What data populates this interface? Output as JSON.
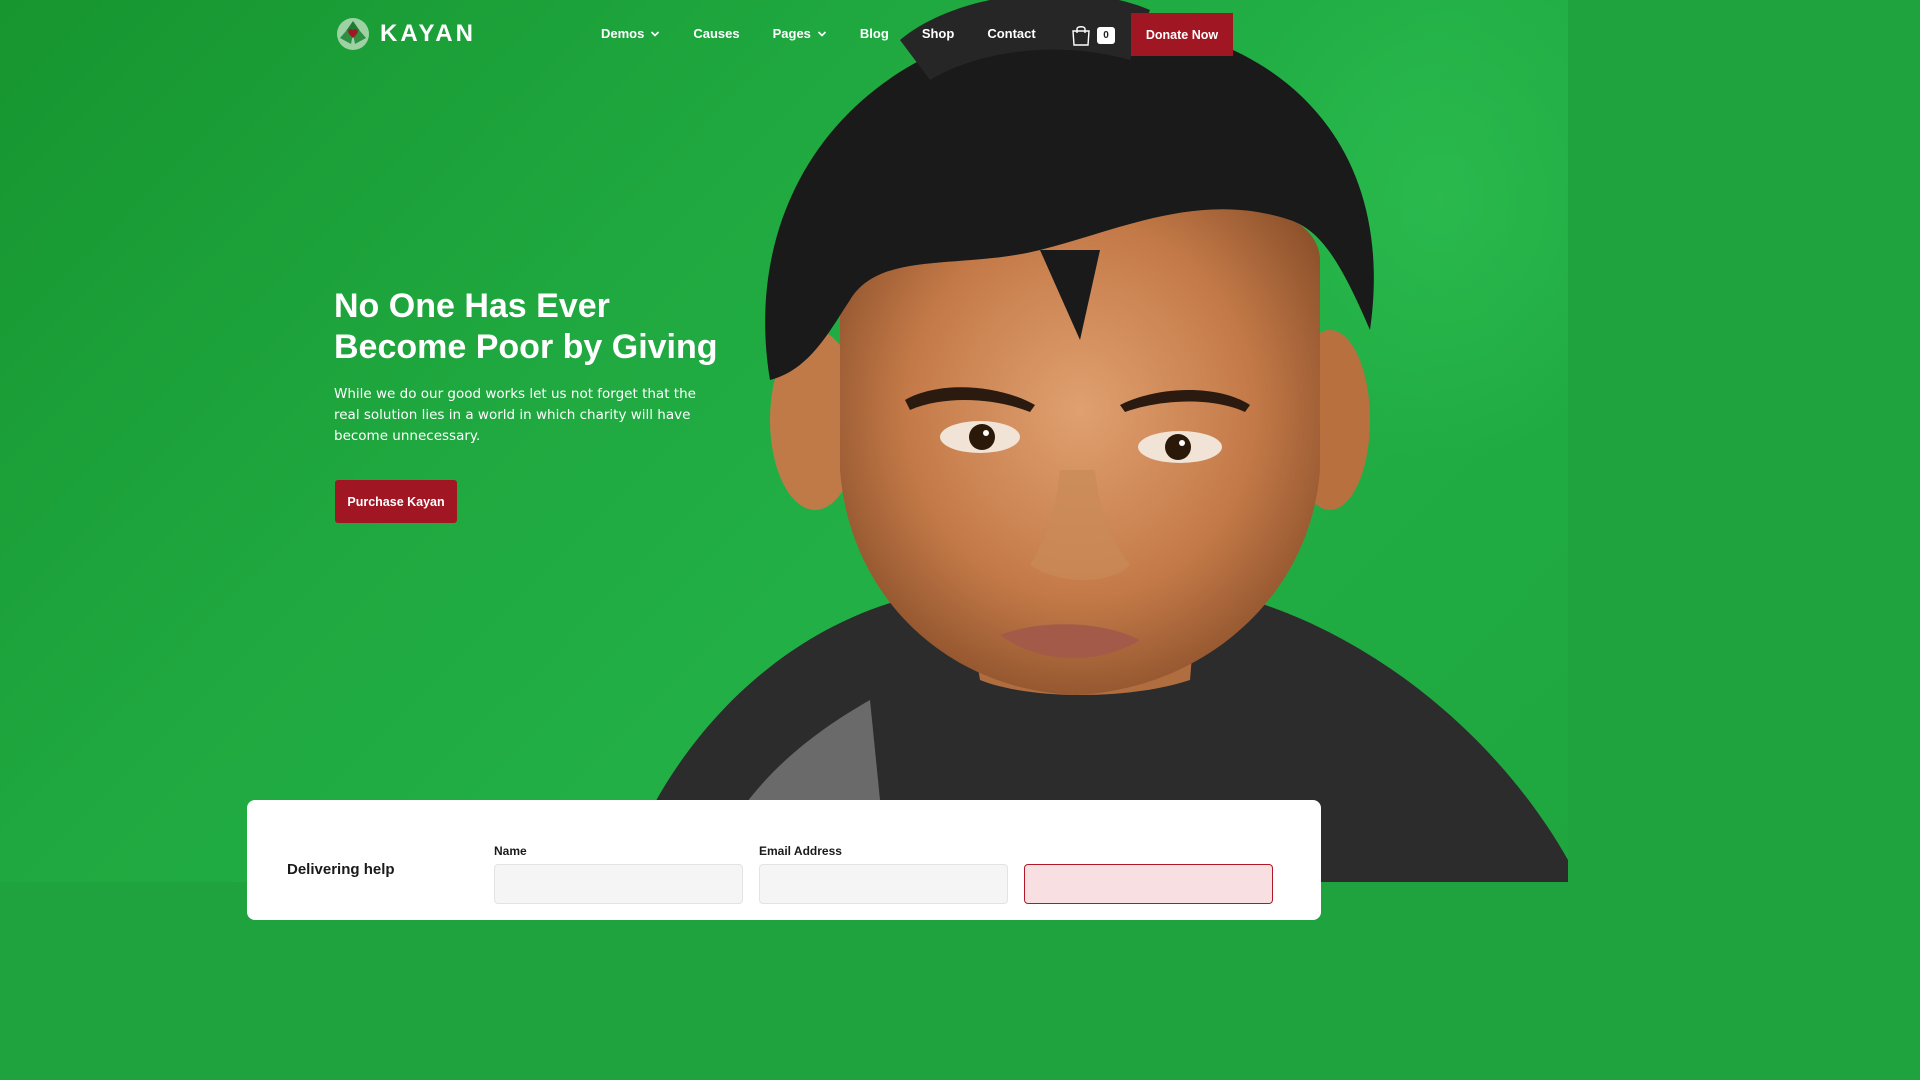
{
  "brand": {
    "name": "KAYAN"
  },
  "nav": {
    "items": [
      {
        "label": "Demos",
        "has_dropdown": true
      },
      {
        "label": "Causes",
        "has_dropdown": false
      },
      {
        "label": "Pages",
        "has_dropdown": true
      },
      {
        "label": "Blog",
        "has_dropdown": false
      },
      {
        "label": "Shop",
        "has_dropdown": false
      },
      {
        "label": "Contact",
        "has_dropdown": false
      }
    ]
  },
  "cart": {
    "icon": "shopping-bag-icon",
    "count": "0"
  },
  "header": {
    "donate_label": "Donate Now"
  },
  "hero": {
    "title_line1": "No One Has Ever",
    "title_line2": "Become Poor by Giving",
    "subtitle": "While we do our good works let us not forget that the real solution lies in a world in which charity will have become unnecessary.",
    "cta_label": "Purchase Kayan"
  },
  "form": {
    "heading": "Delivering help",
    "name_label": "Name",
    "email_label": "Email Address"
  },
  "colors": {
    "hero_green": "#1fa83f",
    "accent_red": "#a01622",
    "white": "#ffffff"
  }
}
